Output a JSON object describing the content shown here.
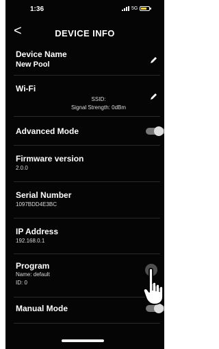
{
  "status": {
    "time": "1:36",
    "network": "5G"
  },
  "header": {
    "title": "DEVICE INFO",
    "back_glyph": "<"
  },
  "device": {
    "label": "Device Name",
    "value": "New Pool"
  },
  "wifi": {
    "label": "Wi-Fi",
    "ssid": "SSID:",
    "signal": "Signal Strength: 0dBm"
  },
  "advanced": {
    "label": "Advanced Mode",
    "enabled": true
  },
  "firmware": {
    "label": "Firmware version",
    "value": "2.0.0"
  },
  "serial": {
    "label": "Serial Number",
    "value": "1097BDD4E3BC"
  },
  "ip": {
    "label": "IP Address",
    "value": "192.168.0.1"
  },
  "program": {
    "label": "Program",
    "name": "Name: default",
    "id": "ID: 0"
  },
  "manual": {
    "label": "Manual Mode",
    "enabled": true
  },
  "icons": {
    "back": "back-chevron-icon",
    "edit": "pencil-icon",
    "pointer": "tap-hand-icon"
  }
}
